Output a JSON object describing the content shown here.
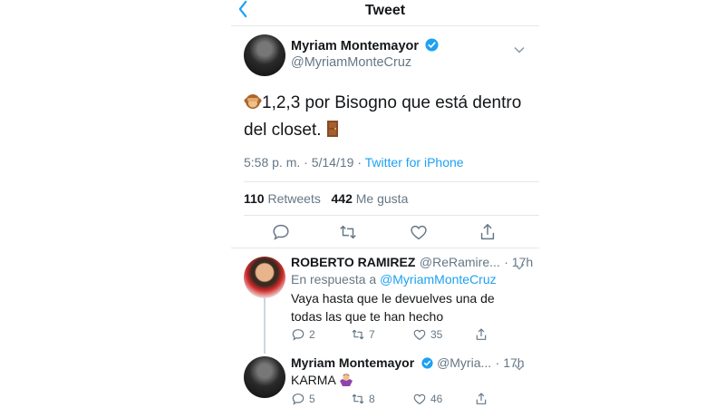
{
  "header": {
    "back_icon": "chevron-left-icon",
    "title": "Tweet"
  },
  "tweet": {
    "author_name": "Myriam Montemayor",
    "author_handle": "@MyriamMonteCruz",
    "text": "1,2,3 por Bisogno que está dentro del closet.",
    "emoji_start": "see-no-evil-monkey-icon",
    "emoji_end": "door-icon",
    "time": "5:58 p. m.",
    "date": "5/14/19",
    "source": "Twitter for iPhone",
    "retweets": "110",
    "retweets_label": "Retweets",
    "likes": "442",
    "likes_label": "Me gusta"
  },
  "replies": [
    {
      "author_name": "ROBERTO RAMIREZ",
      "author_handle": "@ReRamire...",
      "age": "17h",
      "reply_prefix": "En respuesta a",
      "reply_to": "@MyriamMonteCruz",
      "text": "Vaya hasta que le devuelves una de todas las que te han hecho",
      "replies_count": "2",
      "retweets_count": "7",
      "likes_count": "35"
    },
    {
      "author_name": "Myriam Montemayor",
      "author_handle": "@Myria...",
      "age": "17h",
      "text": "KARMA",
      "emoji": "woman-shrugging-icon",
      "replies_count": "5",
      "retweets_count": "8",
      "likes_count": "46"
    }
  ],
  "colors": {
    "accent": "#1da1f2",
    "muted": "#657786",
    "divider": "#e1e8ed"
  }
}
